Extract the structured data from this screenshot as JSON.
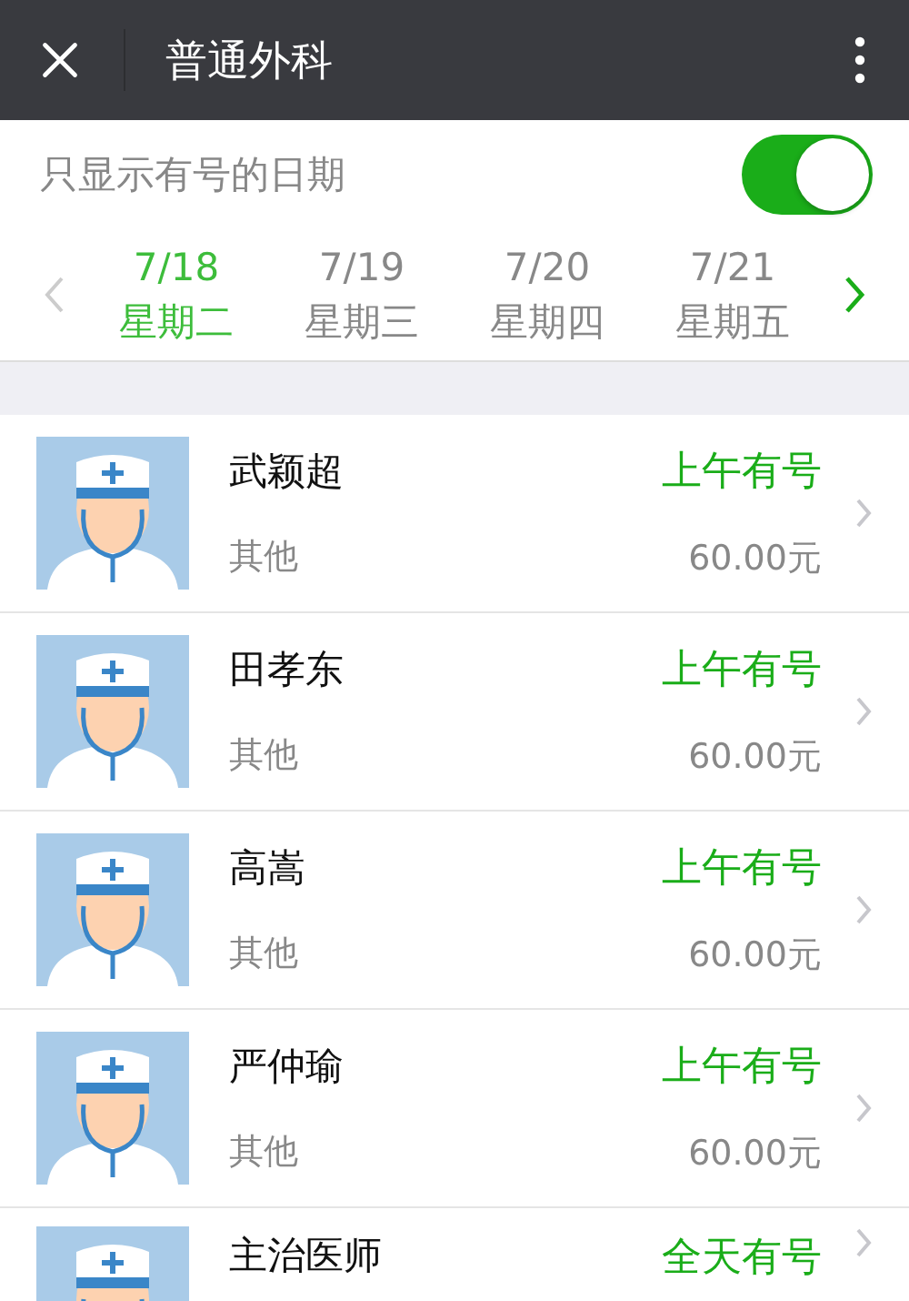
{
  "header": {
    "title": "普通外科"
  },
  "filter": {
    "label": "只显示有号的日期",
    "on": true
  },
  "dates": [
    {
      "date": "7/18",
      "weekday": "星期二",
      "selected": true
    },
    {
      "date": "7/19",
      "weekday": "星期三",
      "selected": false
    },
    {
      "date": "7/20",
      "weekday": "星期四",
      "selected": false
    },
    {
      "date": "7/21",
      "weekday": "星期五",
      "selected": false
    }
  ],
  "doctors": [
    {
      "name": "武颖超",
      "department": "其他",
      "availability": "上午有号",
      "price": "60.00元"
    },
    {
      "name": "田孝东",
      "department": "其他",
      "availability": "上午有号",
      "price": "60.00元"
    },
    {
      "name": "高嵩",
      "department": "其他",
      "availability": "上午有号",
      "price": "60.00元"
    },
    {
      "name": "严仲瑜",
      "department": "其他",
      "availability": "上午有号",
      "price": "60.00元"
    },
    {
      "name": "主治医师",
      "availability": "全天有号"
    }
  ]
}
